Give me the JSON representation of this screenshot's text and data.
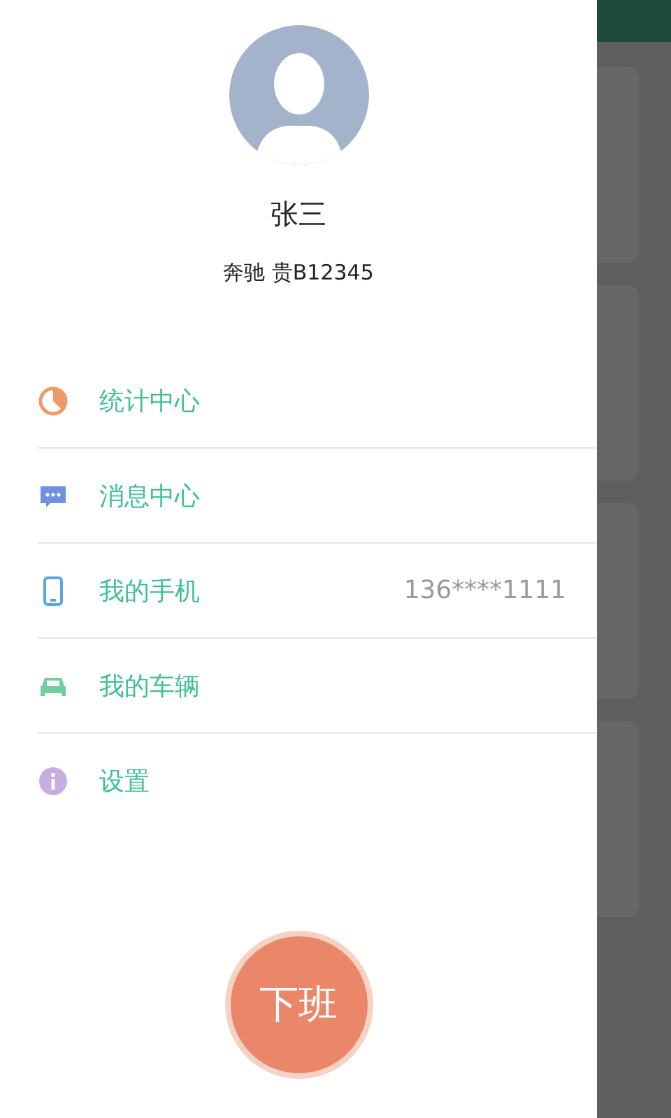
{
  "profile": {
    "name": "张三",
    "vehicle": "奔驰 贵B12345"
  },
  "menu": [
    {
      "kind": "stats",
      "label": "统计中心"
    },
    {
      "kind": "messages",
      "label": "消息中心"
    },
    {
      "kind": "phone",
      "label": "我的手机",
      "value": "136****1111"
    },
    {
      "kind": "car",
      "label": "我的车辆"
    },
    {
      "kind": "settings",
      "label": "设置"
    }
  ],
  "action_button": "下班"
}
